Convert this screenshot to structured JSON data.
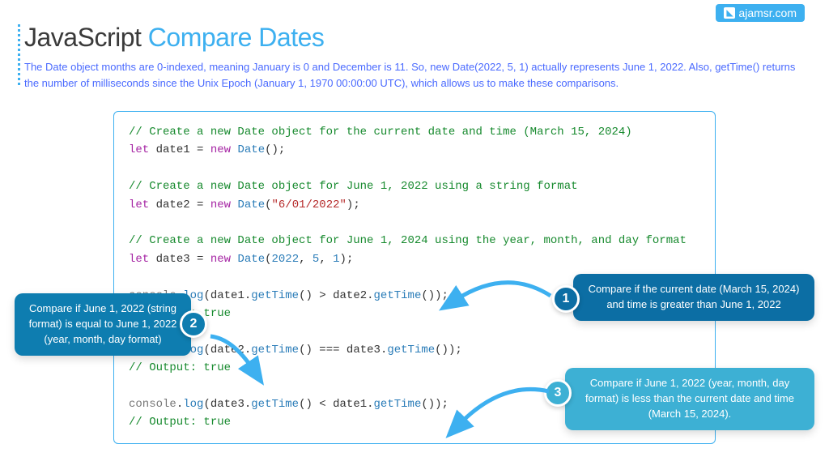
{
  "watermark": "ajamsr.com",
  "title_black": "JavaScript ",
  "title_blue": "Compare Dates",
  "subtitle": "The Date object months are 0-indexed, meaning January is 0 and December is 11. So, new Date(2022, 5, 1) actually represents June 1, 2022. Also, getTime() returns the number of milliseconds since the Unix Epoch (January 1, 1970 00:00:00 UTC), which allows us to make these comparisons.",
  "code": {
    "comment1": "// Create a new Date object for the current date and time (March 15, 2024)",
    "let": "let",
    "new": "new",
    "Date": "Date",
    "date1_var": "date1",
    "date2_var": "date2",
    "date3_var": "date3",
    "comment2": "// Create a new Date object for June 1, 2022 using a string format",
    "string_date": "\"6/01/2022\"",
    "comment3": "// Create a new Date object for June 1, 2024 using the year, month, and day format",
    "year": "2022",
    "month": "5",
    "day": "1",
    "console": "console",
    "log": "log",
    "getTime": "getTime",
    "output_true": "// Output: true",
    "gt": ">",
    "lt": "<",
    "eq": "==="
  },
  "callouts": {
    "c1": {
      "num": "1",
      "text": "Compare if the current date (March 15, 2024) and time is greater than June 1, 2022"
    },
    "c2": {
      "num": "2",
      "text": "Compare if June 1, 2022 (string format) is equal to June 1, 2022 (year, month, day format)"
    },
    "c3": {
      "num": "3",
      "text": "Compare if June 1, 2022 (year, month, day format) is less than the current date and time (March 15, 2024)."
    }
  }
}
